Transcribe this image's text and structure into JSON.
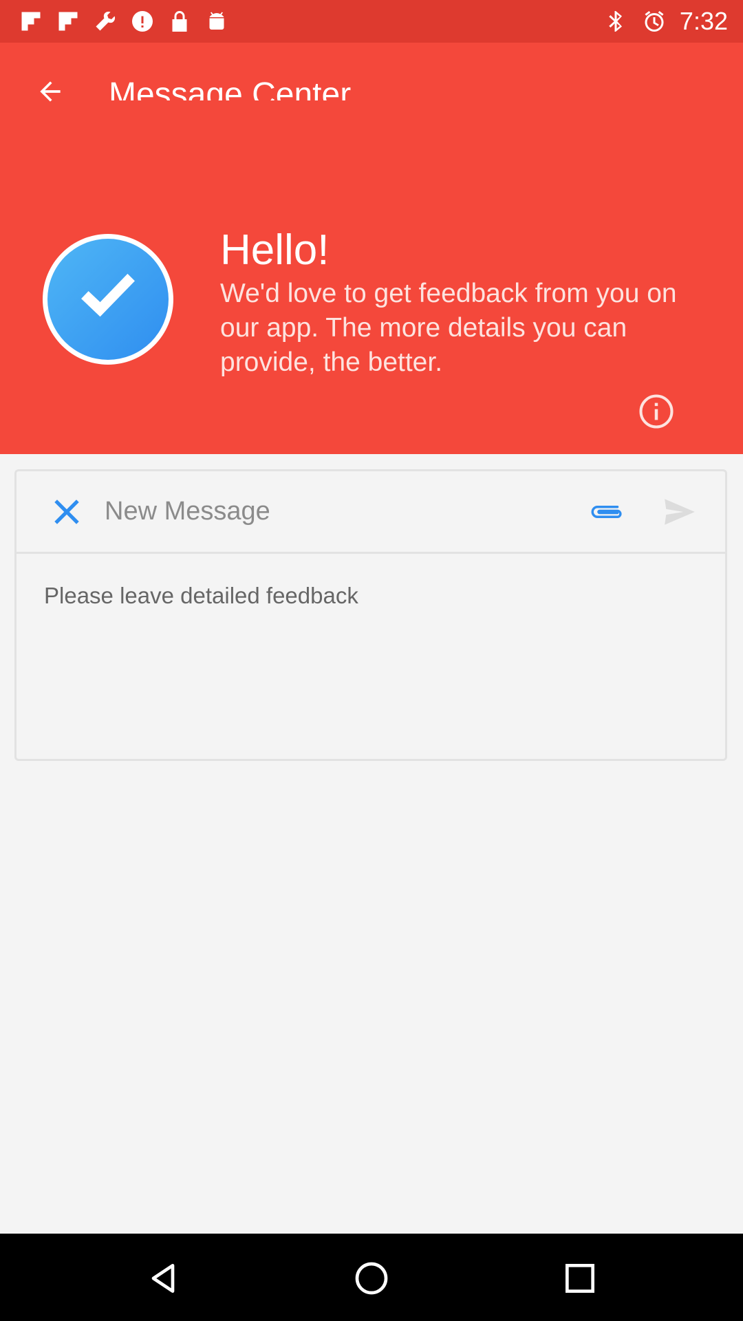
{
  "status_bar": {
    "time": "7:32",
    "left_icons": [
      "flipboard-icon",
      "flipboard-icon",
      "wrench-icon",
      "alert-icon",
      "lock-icon",
      "android-icon"
    ],
    "right_icons": [
      "bluetooth-icon",
      "alarm-icon",
      "signal-icon",
      "battery-icon"
    ]
  },
  "header": {
    "title": "Message Center",
    "hello": "Hello!",
    "intro": "We'd love to get feedback from you on our app. The more details you can provide, the better."
  },
  "compose": {
    "subject_placeholder": "New Message",
    "body_placeholder": "Please leave detailed feedback"
  },
  "colors": {
    "header_bg": "#f4483b",
    "status_bg": "#de3a2f",
    "accent_blue": "#2f8ef0"
  }
}
